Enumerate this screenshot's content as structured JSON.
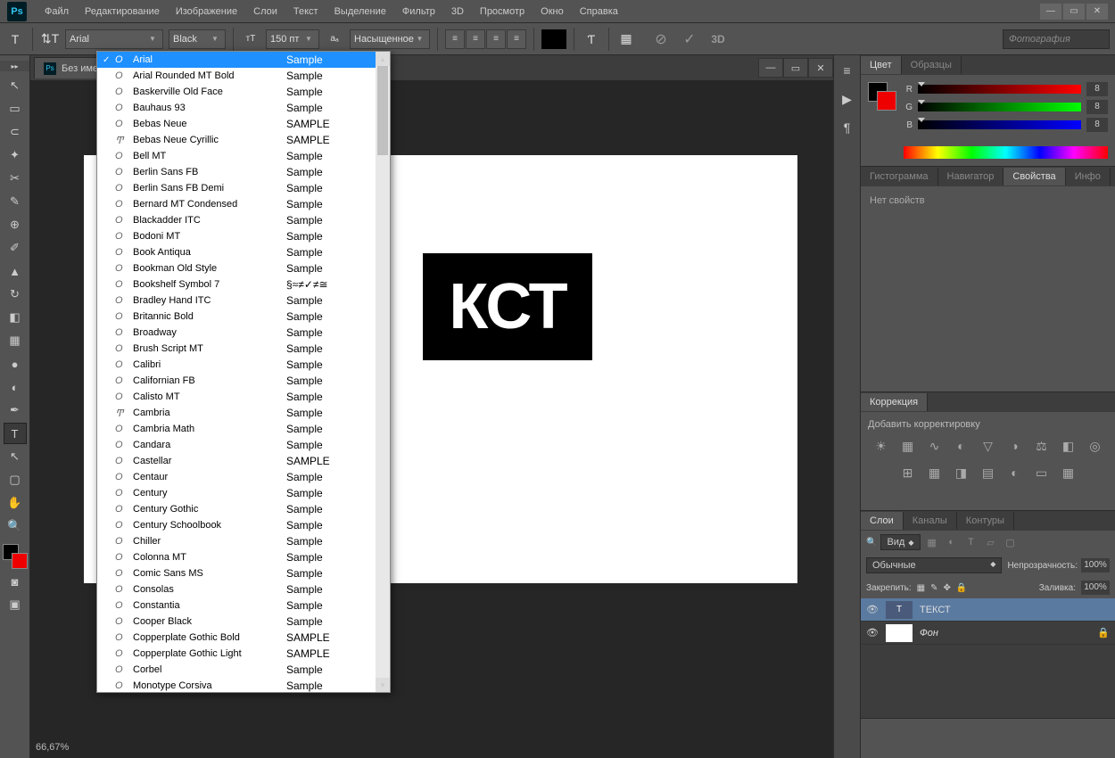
{
  "menu": [
    "Файл",
    "Редактирование",
    "Изображение",
    "Слои",
    "Текст",
    "Выделение",
    "Фильтр",
    "3D",
    "Просмотр",
    "Окно",
    "Справка"
  ],
  "optbar": {
    "font": "Arial",
    "weight": "Black",
    "size": "150 пт",
    "aa": "Насыщенное",
    "search_placeholder": "Фотография"
  },
  "doc": {
    "tab": "Без име",
    "zoom": "66,67%",
    "canvas_text": "КСТ"
  },
  "fonts": [
    {
      "n": "Arial",
      "s": "Sample",
      "sel": true,
      "chk": true
    },
    {
      "n": "Arial Rounded MT Bold",
      "s": "Sample"
    },
    {
      "n": "Baskerville Old Face",
      "s": "Sample"
    },
    {
      "n": "Bauhaus 93",
      "s": "Sample"
    },
    {
      "n": "Bebas Neue",
      "s": "SAMPLE"
    },
    {
      "n": "Bebas Neue Cyrillic",
      "s": "SAMPLE",
      "tt": true
    },
    {
      "n": "Bell MT",
      "s": "Sample"
    },
    {
      "n": "Berlin Sans FB",
      "s": "Sample"
    },
    {
      "n": "Berlin Sans FB Demi",
      "s": "Sample"
    },
    {
      "n": "Bernard MT Condensed",
      "s": "Sample"
    },
    {
      "n": "Blackadder ITC",
      "s": "Sample"
    },
    {
      "n": "Bodoni MT",
      "s": "Sample"
    },
    {
      "n": "Book Antiqua",
      "s": "Sample"
    },
    {
      "n": "Bookman Old Style",
      "s": "Sample"
    },
    {
      "n": "Bookshelf Symbol 7",
      "s": "§≈≠✓≠≅"
    },
    {
      "n": "Bradley Hand ITC",
      "s": "Sample"
    },
    {
      "n": "Britannic Bold",
      "s": "Sample"
    },
    {
      "n": "Broadway",
      "s": "Sample"
    },
    {
      "n": "Brush Script MT",
      "s": "Sample"
    },
    {
      "n": "Calibri",
      "s": "Sample"
    },
    {
      "n": "Californian FB",
      "s": "Sample"
    },
    {
      "n": "Calisto MT",
      "s": "Sample"
    },
    {
      "n": "Cambria",
      "s": "Sample",
      "tt": true
    },
    {
      "n": "Cambria Math",
      "s": "Sample"
    },
    {
      "n": "Candara",
      "s": "Sample"
    },
    {
      "n": "Castellar",
      "s": "SAMPLE"
    },
    {
      "n": "Centaur",
      "s": "Sample"
    },
    {
      "n": "Century",
      "s": "Sample"
    },
    {
      "n": "Century Gothic",
      "s": "Sample"
    },
    {
      "n": "Century Schoolbook",
      "s": "Sample"
    },
    {
      "n": "Chiller",
      "s": "Sample"
    },
    {
      "n": "Colonna MT",
      "s": "Sample"
    },
    {
      "n": "Comic Sans MS",
      "s": "Sample"
    },
    {
      "n": "Consolas",
      "s": "Sample"
    },
    {
      "n": "Constantia",
      "s": "Sample"
    },
    {
      "n": "Cooper Black",
      "s": "Sample"
    },
    {
      "n": "Copperplate Gothic Bold",
      "s": "SAMPLE"
    },
    {
      "n": "Copperplate Gothic Light",
      "s": "SAMPLE"
    },
    {
      "n": "Corbel",
      "s": "Sample"
    },
    {
      "n": "Monotype Corsiva",
      "s": "Sample"
    }
  ],
  "panels": {
    "color": {
      "tabs": [
        "Цвет",
        "Образцы"
      ],
      "r": "8",
      "g": "8",
      "b": "8"
    },
    "histo": {
      "tabs": [
        "Гистограмма",
        "Навигатор",
        "Свойства",
        "Инфо"
      ],
      "empty": "Нет свойств"
    },
    "adj": {
      "tab": "Коррекция",
      "title": "Добавить корректировку"
    },
    "layers": {
      "tabs": [
        "Слои",
        "Каналы",
        "Контуры"
      ],
      "filter": "Вид",
      "blend": "Обычные",
      "opacity_label": "Непрозрачность:",
      "opacity": "100%",
      "lock_label": "Закрепить:",
      "fill_label": "Заливка:",
      "fill": "100%",
      "items": [
        {
          "name": "ТЕКСТ",
          "type": "T",
          "sel": true
        },
        {
          "name": "Фон",
          "type": "bg",
          "lock": true
        }
      ]
    }
  }
}
